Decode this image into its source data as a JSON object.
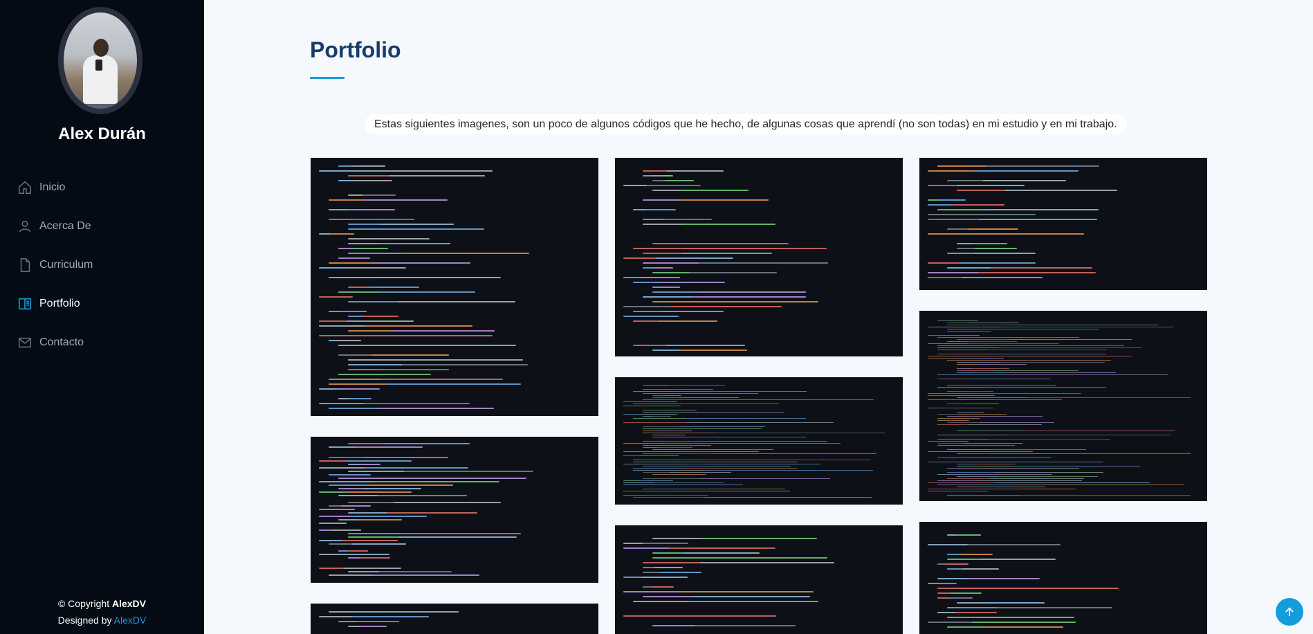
{
  "profile": {
    "name": "Alex Durán"
  },
  "nav": {
    "items": [
      {
        "label": "Inicio",
        "icon": "home-icon"
      },
      {
        "label": "Acerca De",
        "icon": "person-icon"
      },
      {
        "label": "Curriculum",
        "icon": "file-icon"
      },
      {
        "label": "Portfolio",
        "icon": "book-icon"
      },
      {
        "label": "Contacto",
        "icon": "envelope-icon"
      }
    ],
    "active": "Portfolio"
  },
  "footer": {
    "copyright_prefix": "© Copyright",
    "copyright_brand": "AlexDV",
    "designed_prefix": "Designed by",
    "designed_link": "AlexDV"
  },
  "portfolio": {
    "title": "Portfolio",
    "intro": "Estas siguientes imagenes, son un poco de algunos códigos que he hecho, de algunas cosas que aprendí (no son todas) en mi estudio y en mi trabajo.",
    "code_images": [
      "SQL trigger",
      "SQL procedure",
      "SQL function",
      "C# method",
      "XML config",
      "SQL procedure",
      "C# method",
      "Java method",
      "C# event handler"
    ]
  },
  "colors": {
    "sidebar_bg": "#040b14",
    "accent": "#149ddd",
    "title": "#173b6c",
    "page_bg": "#f5f8fd",
    "code_bg": "#0d1117"
  },
  "back_to_top": {
    "icon": "arrow-up-icon"
  }
}
